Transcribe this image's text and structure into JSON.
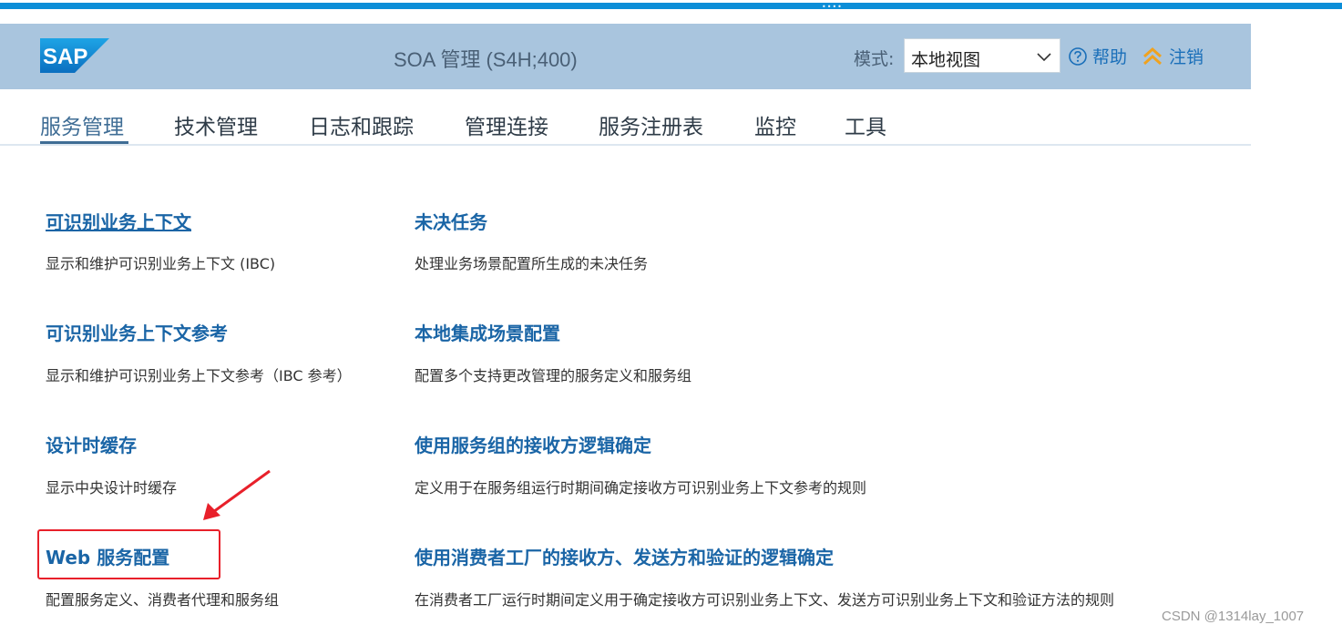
{
  "shell": {
    "logo_text": "SAP",
    "title": "SOA 管理 (S4H;400)",
    "mode_label": "模式:",
    "mode_value": "本地视图",
    "help_label": "帮助",
    "logout_label": "注销"
  },
  "tabs": [
    {
      "label": "服务管理",
      "active": true
    },
    {
      "label": "技术管理"
    },
    {
      "label": "日志和跟踪"
    },
    {
      "label": "管理连接"
    },
    {
      "label": "服务注册表"
    },
    {
      "label": "监控"
    },
    {
      "label": "工具"
    }
  ],
  "items": [
    {
      "title": "可识别业务上下文",
      "desc": "显示和维护可识别业务上下文 (IBC)"
    },
    {
      "title": "未决任务",
      "desc": "处理业务场景配置所生成的未决任务"
    },
    {
      "title": "可识别业务上下文参考",
      "desc": "显示和维护可识别业务上下文参考（IBC 参考）"
    },
    {
      "title": "本地集成场景配置",
      "desc": "配置多个支持更改管理的服务定义和服务组"
    },
    {
      "title": "设计时缓存",
      "desc": "显示中央设计时缓存"
    },
    {
      "title": "使用服务组的接收方逻辑确定",
      "desc": "定义用于在服务组运行时期间确定接收方可识别业务上下文参考的规则"
    },
    {
      "title": "Web 服务配置",
      "desc": "配置服务定义、消费者代理和服务组"
    },
    {
      "title": "使用消费者工厂的接收方、发送方和验证的逻辑确定",
      "desc": "在消费者工厂运行时期间定义用于确定接收方可识别业务上下文、发送方可识别业务上下文和验证方法的规则"
    }
  ],
  "colors": {
    "shell_bg": "#a9c5de",
    "link": "#1a65a6",
    "annotation": "#e8202a",
    "top_bar": "#0c8ed8"
  },
  "watermark": "CSDN @1314lay_1007"
}
